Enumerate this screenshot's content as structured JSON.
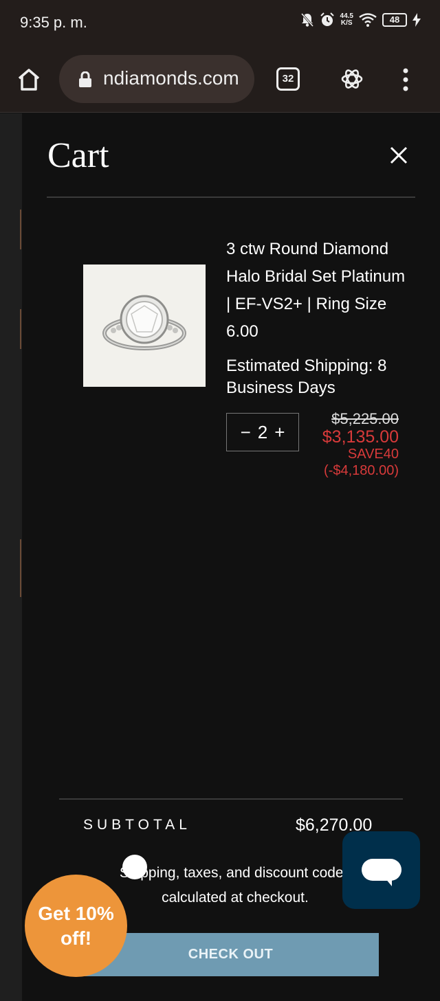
{
  "status_bar": {
    "time": "9:35 p. m.",
    "net_speed_value": "44.5",
    "net_speed_unit": "K/S",
    "battery": "48"
  },
  "browser": {
    "url": "ndiamonds.com",
    "tab_count": "32"
  },
  "cart": {
    "title": "Cart",
    "item": {
      "name": "3 ctw Round Diamond Halo Bridal Set Platinum | EF-VS2+ | Ring Size 6.00",
      "shipping": "Estimated Shipping: 8 Business Days",
      "quantity": "2",
      "qty_minus": "−",
      "qty_plus": "+",
      "original_price": "$5,225.00",
      "sale_price": "$3,135.00",
      "promo_code": "SAVE40",
      "discount": "(-$4,180.00)"
    },
    "subtotal_label": "SUBTOTAL",
    "subtotal_value": "$6,270.00",
    "note": "Shipping, taxes, and discount codes calculated at checkout.",
    "checkout_label": "CHECK OUT"
  },
  "overlays": {
    "discount_badge": "Get 10% off!"
  },
  "colors": {
    "drawer_bg": "#111111",
    "sale_red": "#d83a3a",
    "checkout_blue": "#6f9bb2",
    "chat_navy": "#002f4b",
    "badge_orange": "#ed953a"
  }
}
